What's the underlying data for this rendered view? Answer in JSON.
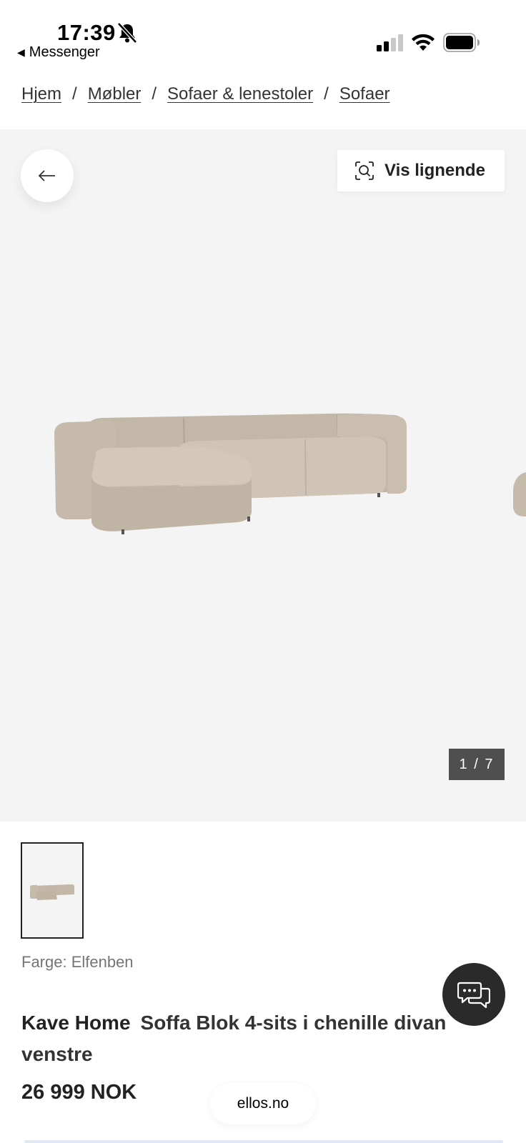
{
  "status_bar": {
    "time": "17:39",
    "back_app": "Messenger",
    "icons": [
      "bell-off-icon",
      "signal-icon",
      "wifi-icon",
      "battery-icon"
    ]
  },
  "breadcrumb": {
    "items": [
      "Hjem",
      "Møbler",
      "Sofaer & lenestoler",
      "Sofaer"
    ],
    "separator": "/"
  },
  "gallery": {
    "similar_label": "Vis lignende",
    "counter": "1 / 7",
    "current_image": 1,
    "total_images": 7
  },
  "product": {
    "color_label": "Farge: Elfenben",
    "brand": "Kave Home",
    "name": "Soffa Blok 4-sits i chenille divan venstre",
    "price": "26 999 NOK"
  },
  "browser": {
    "domain": "ellos.no"
  },
  "colors": {
    "gallery_bg": "#f4f4f4",
    "sofa": "#c8bdae",
    "counter_bg": "#4f4f4f",
    "chat_bg": "#2a2a2a"
  }
}
